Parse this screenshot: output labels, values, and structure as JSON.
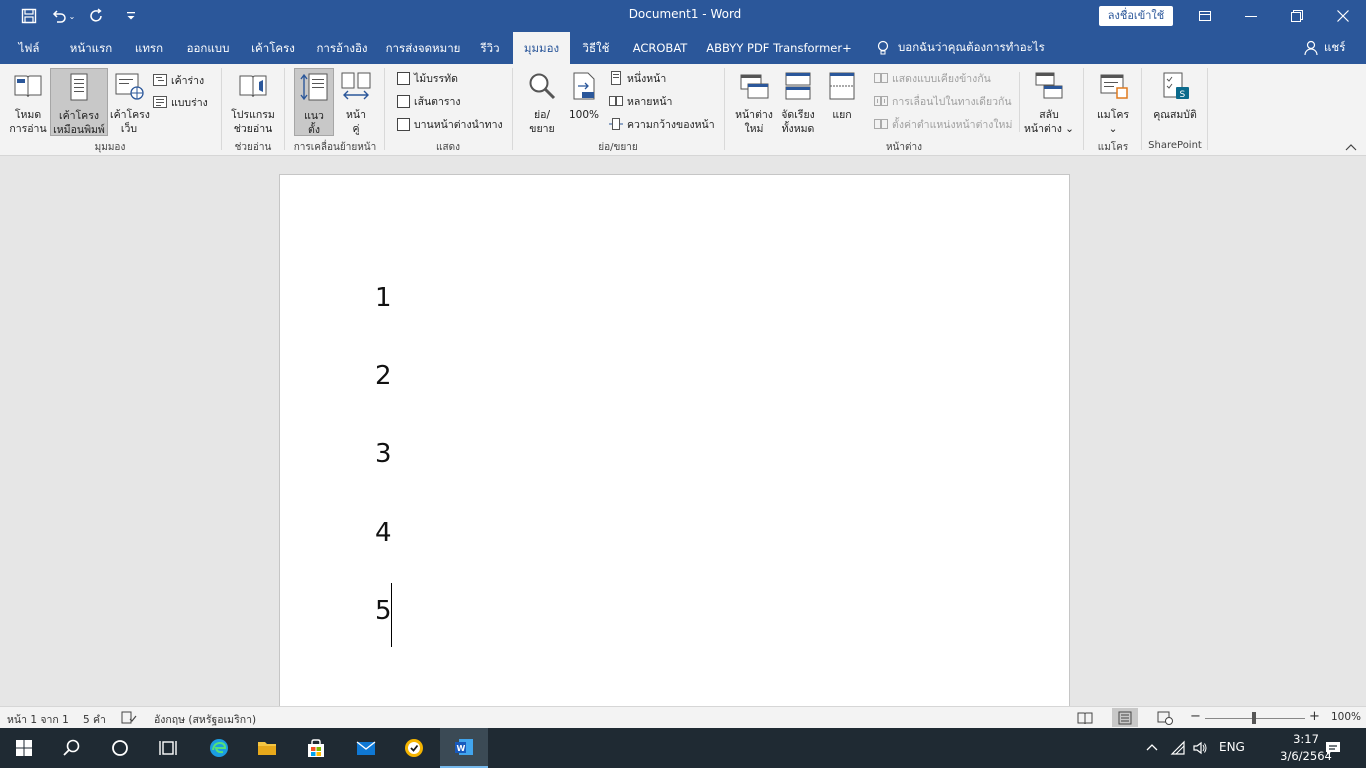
{
  "titlebar": {
    "doc_title": "Document1  -  Word",
    "signin_label": "ลงชื่อเข้าใช้"
  },
  "tabs": {
    "items": [
      {
        "label": "ไฟล์"
      },
      {
        "label": "หน้าแรก"
      },
      {
        "label": "แทรก"
      },
      {
        "label": "ออกแบบ"
      },
      {
        "label": "เค้าโครง"
      },
      {
        "label": "การอ้างอิง"
      },
      {
        "label": "การส่งจดหมาย"
      },
      {
        "label": "รีวิว"
      },
      {
        "label": "มุมมอง"
      },
      {
        "label": "วิธีใช้"
      },
      {
        "label": "ACROBAT"
      },
      {
        "label": "ABBYY PDF Transformer+"
      }
    ],
    "tell_me": "บอกฉันว่าคุณต้องการทำอะไร",
    "share": "แชร์"
  },
  "ribbon": {
    "views": {
      "label": "มุมมอง",
      "read_mode": [
        "โหมด",
        "การอ่าน"
      ],
      "print_layout": [
        "เค้าโครง",
        "เหมือนพิมพ์"
      ],
      "web_layout": [
        "เค้าโครง",
        "เว็บ"
      ],
      "outline": "เค้าร่าง",
      "draft": "แบบร่าง"
    },
    "immersive": {
      "label": "ช่วยอ่าน",
      "reader": [
        "โปรแกรม",
        "ช่วยอ่าน"
      ]
    },
    "page_movement": {
      "label": "การเคลื่อนย้ายหน้า",
      "vertical": [
        "แนว",
        "ตั้ง"
      ],
      "side_to_side": [
        "หน้า",
        "คู่"
      ]
    },
    "show": {
      "label": "แสดง",
      "ruler": "ไม้บรรทัด",
      "gridlines": "เส้นตาราง",
      "nav_pane": "บานหน้าต่างนำทาง"
    },
    "zoom": {
      "label": "ย่อ/ขยาย",
      "zoom": [
        "ย่อ/",
        "ขยาย"
      ],
      "hundred": "100%",
      "one_page": "หนึ่งหน้า",
      "multi_page": "หลายหน้า",
      "page_width": "ความกว้างของหน้า"
    },
    "window": {
      "label": "หน้าต่าง",
      "new_window": [
        "หน้าต่าง",
        "ใหม่"
      ],
      "arrange_all": [
        "จัดเรียง",
        "ทั้งหมด"
      ],
      "split": "แยก",
      "side_by_side": "แสดงแบบเคียงข้างกัน",
      "sync_scroll": "การเลื่อนไปในทางเดียวกัน",
      "reset_pos": "ตั้งค่าตำแหน่งหน้าต่างใหม่",
      "switch": [
        "สลับ",
        "หน้าต่าง ⌄"
      ]
    },
    "macros": {
      "label": "แมโคร",
      "macros": [
        "แมโคร",
        "⌄"
      ]
    },
    "sharepoint": {
      "label": "SharePoint",
      "properties": "คุณสมบัติ"
    }
  },
  "document": {
    "lines": [
      "1",
      "2",
      "3",
      "4",
      "5"
    ]
  },
  "statusbar": {
    "page": "หน้า 1 จาก 1",
    "words": "5 คำ",
    "language": "อังกฤษ (สหรัฐอเมริกา)",
    "zoom_level": "100%",
    "zoom_minus": "−",
    "zoom_plus": "+"
  },
  "taskbar": {
    "lang": "ENG",
    "time": "3:17",
    "date": "3/6/2564"
  },
  "colors": {
    "word_blue": "#2b579a",
    "ribbon_bg": "#f3f3f3",
    "canvas_bg": "#e6e6e6",
    "taskbar_bg": "#1f2a33"
  }
}
